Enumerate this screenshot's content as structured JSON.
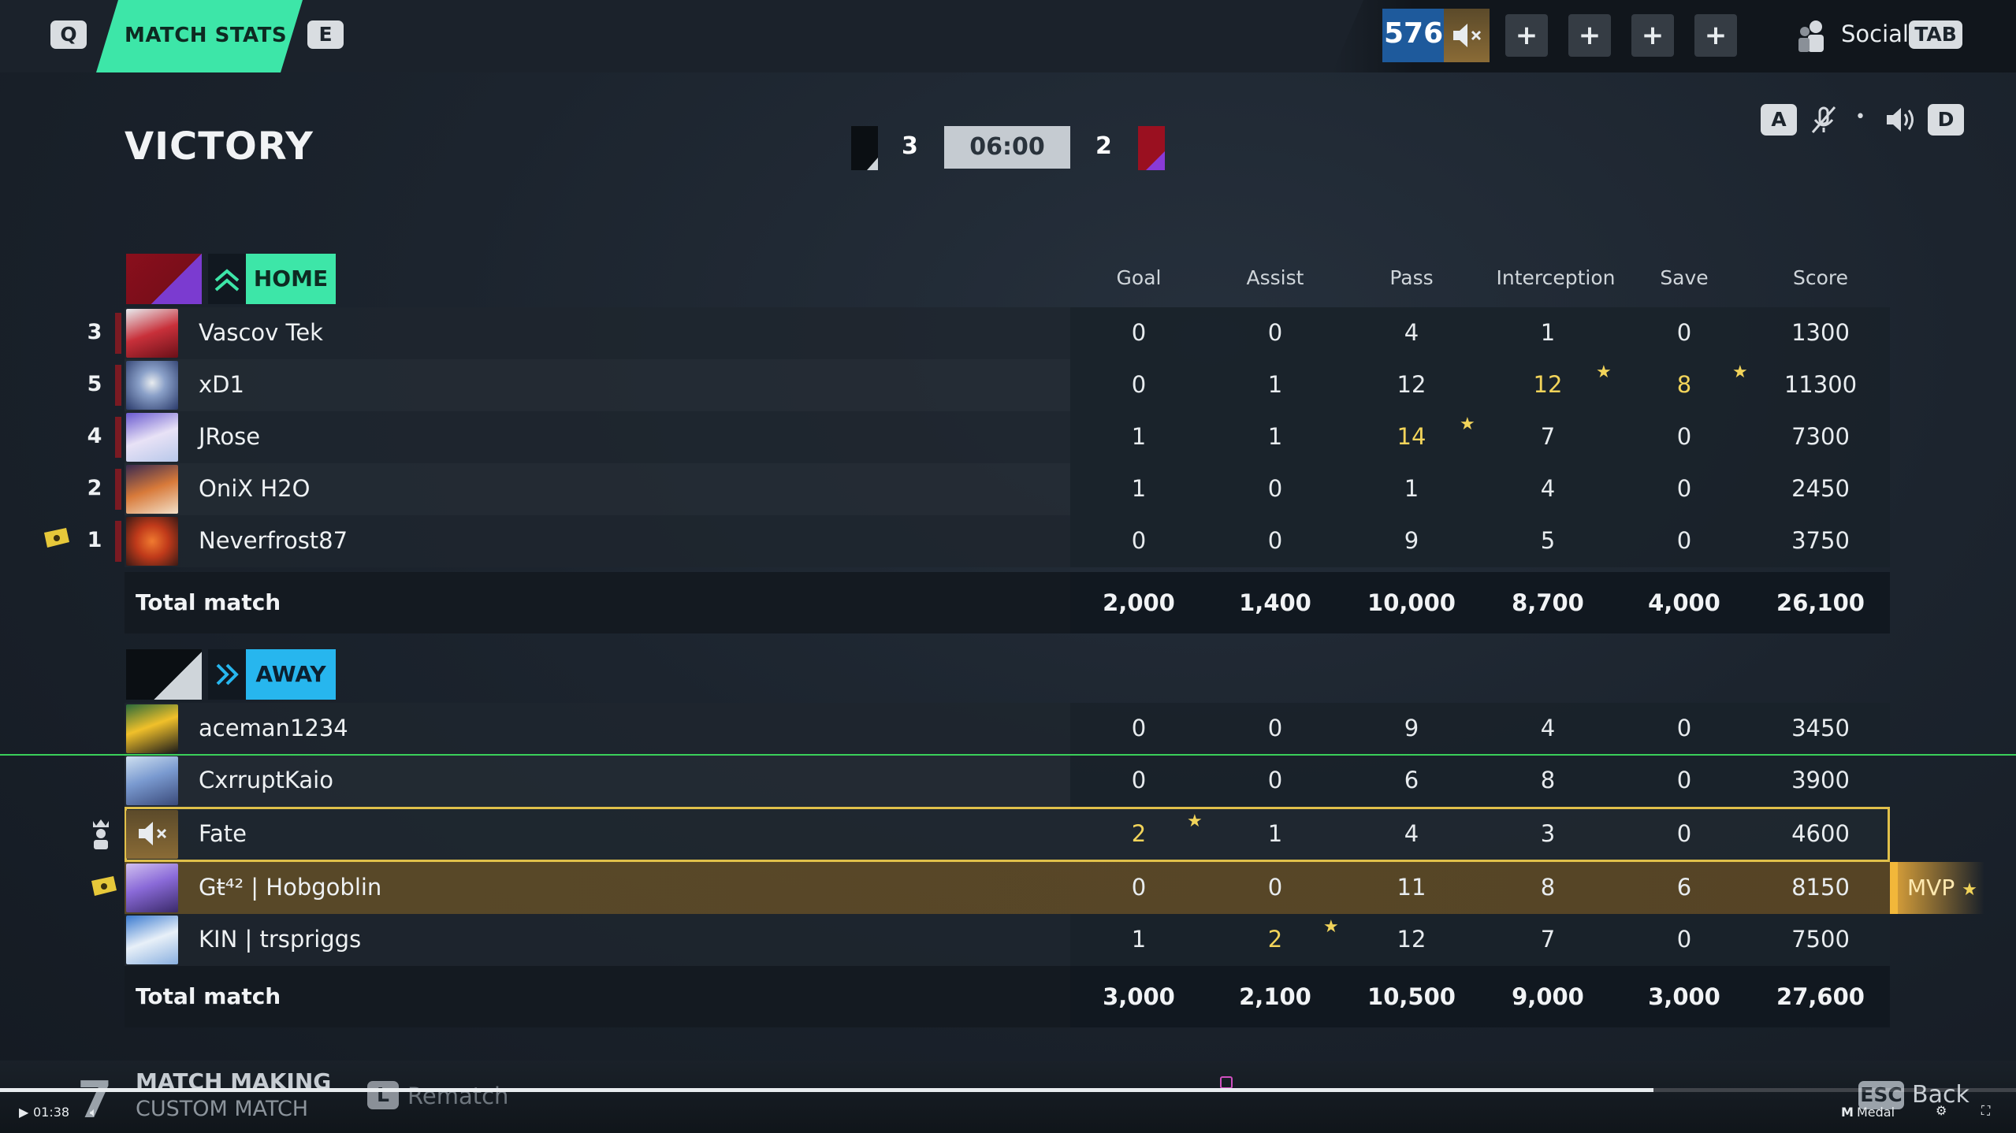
{
  "top_bar": {
    "left_key": "Q",
    "active_tab": "MATCH STATS",
    "right_key": "E",
    "currency": "576",
    "plus_buttons": [
      "+",
      "+",
      "+",
      "+"
    ],
    "social_label": "Social",
    "social_key": "TAB"
  },
  "match": {
    "result": "VICTORY",
    "home_score": "3",
    "timer": "06:00",
    "away_score": "2",
    "controls": {
      "left_key": "A",
      "right_key": "D",
      "separator": "•"
    }
  },
  "columns": [
    "Goal",
    "Assist",
    "Pass",
    "Interception",
    "Save",
    "Score"
  ],
  "home": {
    "label": "HOME",
    "color": "#3de6a8",
    "players": [
      {
        "rank": "3",
        "name": "Vascov Tek",
        "stats": [
          "0",
          "0",
          "4",
          "1",
          "0",
          "1300"
        ],
        "avatar_icon": "red-character-avatar"
      },
      {
        "rank": "5",
        "name": "xD1",
        "stats": [
          "0",
          "1",
          "12",
          "12",
          "8",
          "11300"
        ],
        "avatar_icon": "robot-avatar"
      },
      {
        "rank": "4",
        "name": "JRose",
        "stats": [
          "1",
          "1",
          "14",
          "7",
          "0",
          "7300"
        ],
        "avatar_icon": "unicorn-avatar"
      },
      {
        "rank": "2",
        "name": "OniX H2O",
        "stats": [
          "1",
          "0",
          "1",
          "4",
          "0",
          "2450"
        ],
        "avatar_icon": "fox-avatar"
      },
      {
        "rank": "1",
        "name": "Neverfrost87",
        "stats": [
          "0",
          "0",
          "9",
          "5",
          "0",
          "3750"
        ],
        "avatar_icon": "orb-avatar"
      }
    ],
    "total_label": "Total match",
    "totals": [
      "2,000",
      "1,400",
      "10,000",
      "8,700",
      "4,000",
      "26,100"
    ]
  },
  "away": {
    "label": "AWAY",
    "color": "#27b6ee",
    "players": [
      {
        "name": "aceman1234",
        "stats": [
          "0",
          "0",
          "9",
          "4",
          "0",
          "3450"
        ],
        "avatar_icon": "toucan-avatar"
      },
      {
        "name": "CxrruptKaio",
        "stats": [
          "0",
          "0",
          "6",
          "8",
          "0",
          "3900"
        ],
        "avatar_icon": "bird-avatar"
      },
      {
        "name": "Fate",
        "stats": [
          "2",
          "1",
          "4",
          "3",
          "0",
          "4600"
        ],
        "avatar_icon": "muted-speaker-avatar"
      },
      {
        "name": "Gŧ⁴² | Hobgoblin",
        "stats": [
          "0",
          "0",
          "11",
          "8",
          "6",
          "8150"
        ],
        "avatar_icon": "dragon-avatar"
      },
      {
        "name": "KIN | trspriggs",
        "stats": [
          "1",
          "2",
          "12",
          "7",
          "0",
          "7500"
        ],
        "avatar_icon": "eagle-avatar"
      }
    ],
    "total_label": "Total match",
    "totals": [
      "3,000",
      "2,100",
      "10,500",
      "9,000",
      "3,000",
      "27,600"
    ],
    "mvp_label": "MVP"
  },
  "bottom_bar": {
    "number": "7",
    "mode_title": "MATCH MAKING",
    "mode_subtitle": "CUSTOM MATCH",
    "rematch_key": "L",
    "rematch_label": "Rematch",
    "back_key": "ESC",
    "back_label": "Back"
  },
  "video_overlay": {
    "time": "01:38",
    "progress": 0.82,
    "brand": "Medal"
  }
}
